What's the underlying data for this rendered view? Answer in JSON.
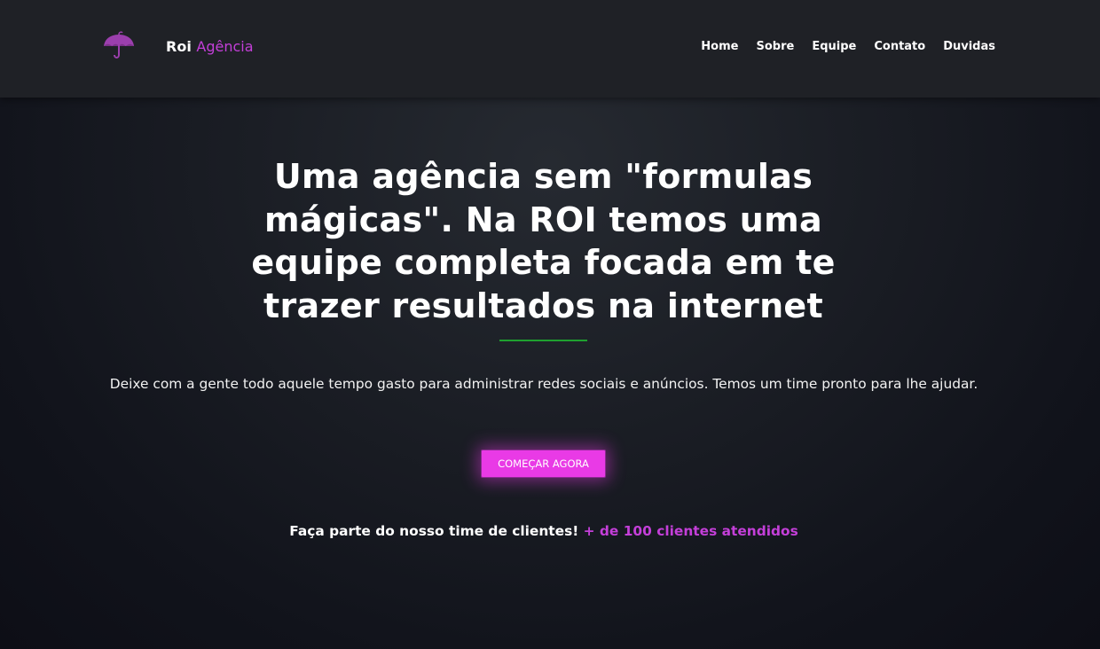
{
  "header": {
    "logo_icon": "umbrella-icon",
    "brand_name": "Roi",
    "brand_accent": "Agência",
    "nav": [
      "Home",
      "Sobre",
      "Equipe",
      "Contato",
      "Duvidas"
    ]
  },
  "hero": {
    "title": "Uma agência sem \"formulas mágicas\". Na ROI temos uma equipe completa focada em te trazer resultados na internet",
    "subtitle": "Deixe com a gente todo aquele tempo gasto para administrar redes sociais e anúncios. Temos um time pronto para lhe ajudar.",
    "cta_label": "COMEÇAR AGORA",
    "clients_text": "Faça parte do nosso time de clientes!",
    "clients_highlight": "+ de 100 clientes atendidos"
  },
  "colors": {
    "accent": "#c43fd9",
    "button": "#e93ae6",
    "divider": "#1fa12f",
    "header_bg": "#1f2126",
    "page_bg": "#161820"
  }
}
